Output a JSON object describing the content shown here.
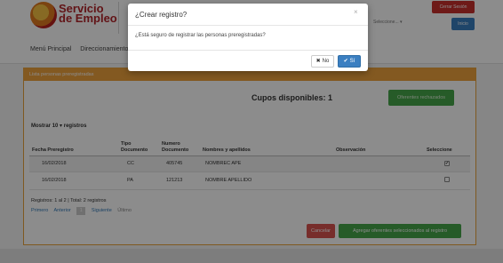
{
  "header": {
    "brand_line1": "Servicio",
    "brand_line2": "de Empleo",
    "close_session": "Cerrar Sesión",
    "select_placeholder": "Seleccione... ▾",
    "blue_button": "Inicio"
  },
  "nav": {
    "items": [
      "Menú Principal",
      "Direccionamiento"
    ]
  },
  "panel": {
    "title": "Lista personas preregistradas",
    "cupos": "Cupos disponibles: 1",
    "rejected_button": "Oferentes rechazados",
    "show_prefix": "Mostrar",
    "show_value": "10",
    "show_suffix": "registros",
    "table": {
      "headers": [
        "Fecha Preregistro",
        "Tipo Documento",
        "Numero Documento",
        "Nombres y apellidos",
        "Observación",
        "Seleccione"
      ],
      "rows": [
        {
          "fecha": "16/02/2018",
          "tipo": "CC",
          "numero": "405745",
          "nombre": "NOMBREC APE",
          "observacion": "",
          "checked": true
        },
        {
          "fecha": "16/02/2018",
          "tipo": "PA",
          "numero": "121213",
          "nombre": "NOMBRE APELLIDO",
          "observacion": "",
          "checked": false
        }
      ]
    },
    "records": "Registros: 1 al 2 | Total: 2 registros",
    "pager": {
      "first": "Primero",
      "prev": "Anterior",
      "current": "1",
      "next": "Siguiente",
      "last": "Último"
    },
    "cancel_button": "Cancelar",
    "add_button": "Agregar oferentes seleccionados al registro"
  },
  "modal": {
    "title": "¿Crear registro?",
    "close_glyph": "×",
    "body": "¿Está seguro de registrar las personas preregistradas?",
    "no_label": "No",
    "yes_label": "Sí",
    "no_icon": "x-icon",
    "yes_icon": "check-icon"
  },
  "colors": {
    "accent_orange": "#efa23c",
    "primary_blue": "#3b7fc1",
    "success_green": "#46a64a",
    "danger_red": "#d9534f",
    "brand_red": "#b3252b"
  }
}
